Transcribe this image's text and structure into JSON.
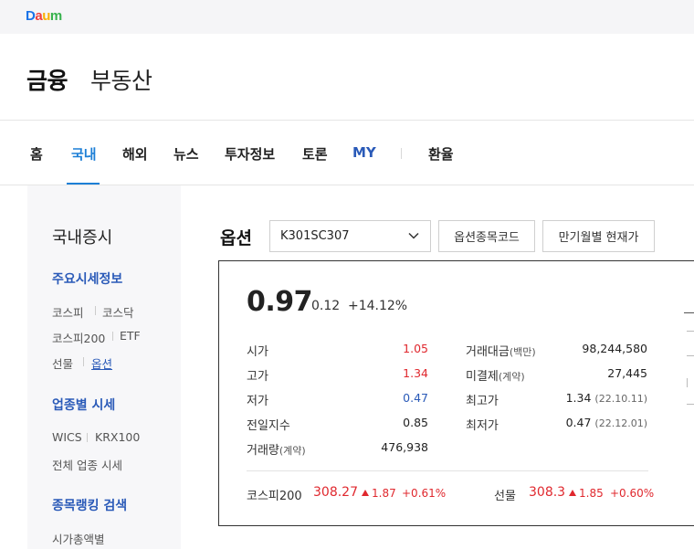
{
  "topbar": {
    "logo_letters": [
      {
        "char": "D",
        "color": "#1a73e8"
      },
      {
        "char": "a",
        "color": "#f03e3e"
      },
      {
        "char": "u",
        "color": "#fab005"
      },
      {
        "char": "m",
        "color": "#37b24d"
      }
    ]
  },
  "service": {
    "title": "금융",
    "sub": "부동산"
  },
  "gnb": {
    "items": [
      "홈",
      "국내",
      "해외",
      "뉴스",
      "투자정보",
      "토론",
      "MY",
      "환율"
    ],
    "active": "국내",
    "accent_color": "#1d7fd6"
  },
  "lnb": {
    "title": "국내증시",
    "sections": [
      {
        "label": "주요시세정보",
        "links": [
          "코스피",
          "코스닥",
          "코스피200",
          "ETF",
          "선물",
          "옵션"
        ]
      },
      {
        "label": "업종별 시세",
        "links": [
          "WICS",
          "KRX100",
          "전체 업종 시세"
        ]
      },
      {
        "label": "종목랭킹 검색",
        "links": [
          "시가총액별"
        ]
      }
    ],
    "current": "옵션"
  },
  "option": {
    "title": "옵션",
    "select_value": "K301SC307",
    "btn_code": "옵션종목코드",
    "btn_month": "만기월별 현재가"
  },
  "quote": {
    "price": "0.97",
    "change": "0.12",
    "change_pct": "+14.12%",
    "left": [
      {
        "label": "시가",
        "value": "1.05",
        "tone": "red"
      },
      {
        "label": "고가",
        "value": "1.34",
        "tone": "red"
      },
      {
        "label": "저가",
        "value": "0.47",
        "tone": "blue"
      },
      {
        "label": "전일지수",
        "value": "0.85",
        "tone": "normal"
      },
      {
        "label": "거래량",
        "label_small": "(계약)",
        "value": "476,938",
        "tone": "normal"
      }
    ],
    "right": [
      {
        "label": "거래대금",
        "label_small": "(백만)",
        "value": "98,244,580"
      },
      {
        "label": "미결제",
        "label_small": "(계약)",
        "value": "27,445"
      },
      {
        "label": "최고가",
        "value": "1.34",
        "value_small": "(22.10.11)"
      },
      {
        "label": "최저가",
        "value": "0.47",
        "value_small": "(22.12.01)"
      }
    ]
  },
  "indices": [
    {
      "name": "코스피200",
      "value": "308.27",
      "change": "1.87",
      "pct": "+0.61%"
    },
    {
      "name": "선물",
      "value": "308.3",
      "change": "1.85",
      "pct": "+0.60%"
    }
  ]
}
